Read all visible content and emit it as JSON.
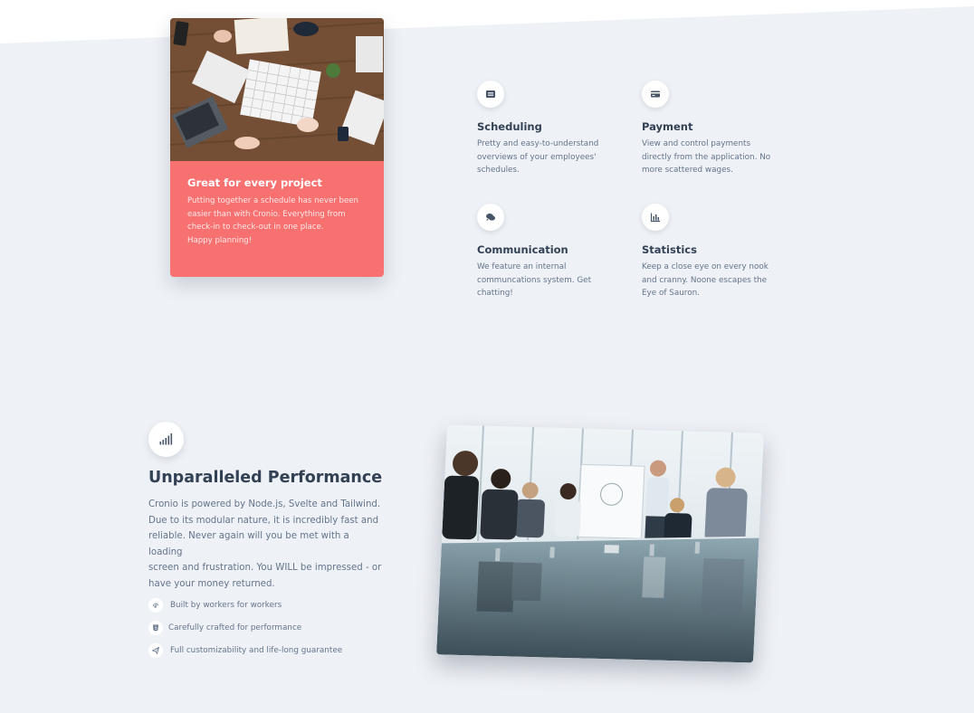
{
  "colors": {
    "background": "#eef1f6",
    "accent": "#f87171",
    "heading": "#334155",
    "body_text": "#64748b"
  },
  "project_card": {
    "title": "Great for every project",
    "text_lines": [
      "Putting together a schedule has never been",
      "easier than with Cronio. Everything from",
      "check-in to check-out in one place.",
      "Happy planning!"
    ]
  },
  "features": [
    {
      "icon": "list-icon",
      "title": "Scheduling",
      "lines": [
        "Pretty and easy-to-understand",
        "overviews of your employees'",
        "schedules."
      ]
    },
    {
      "icon": "credit-card-icon",
      "title": "Payment",
      "lines": [
        "View and control payments",
        "directly from the application. No",
        "more scattered wages."
      ]
    },
    {
      "icon": "comments-icon",
      "title": "Communication",
      "lines": [
        "We feature an internal",
        "communcations system. Get",
        "chatting!"
      ]
    },
    {
      "icon": "chart-bar-icon",
      "title": "Statistics",
      "lines": [
        "Keep a close eye on every nook",
        "and cranny. Noone escapes the",
        "Eye of Sauron."
      ]
    }
  ],
  "performance": {
    "icon": "signal-bars-icon",
    "title": "Unparalleled Performance",
    "text_lines": [
      "Cronio is powered by Node.js, Svelte and Tailwind.",
      "Due to its modular nature, it is incredibly fast and",
      "reliable. Never again will you be met with a loading",
      "screen and frustration. You WILL be impressed - or",
      "have your money returned."
    ],
    "list": [
      {
        "icon": "fingerprint-icon",
        "label": "Built by workers for workers"
      },
      {
        "icon": "html5-icon",
        "label": "Carefully crafted for performance"
      },
      {
        "icon": "paper-plane-icon",
        "label": "Full customizability and life-long guarantee"
      }
    ]
  }
}
